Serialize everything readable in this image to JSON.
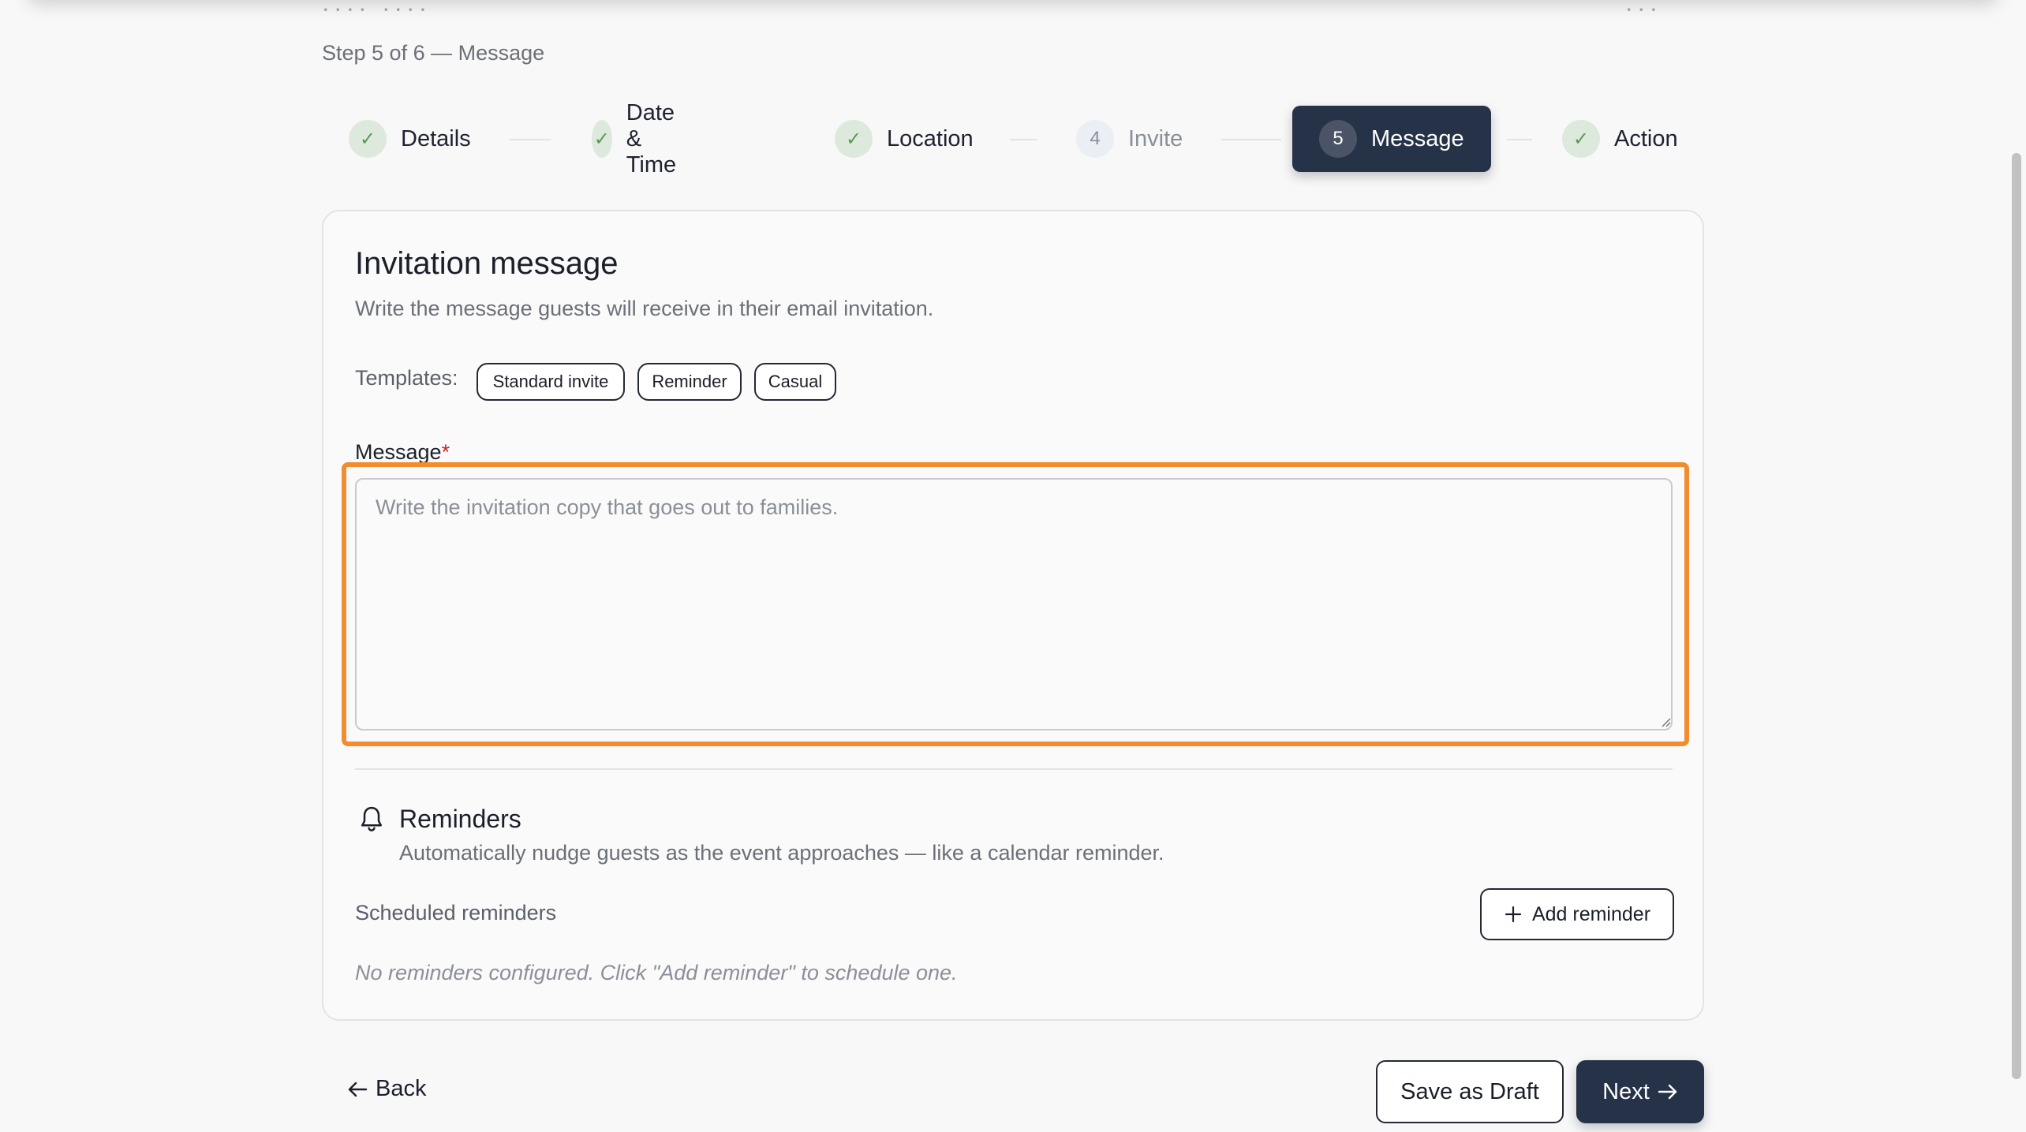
{
  "header": {
    "step_indicator": "Step 5 of 6 — Message"
  },
  "stepper": {
    "steps": [
      {
        "label": "Details",
        "state": "done",
        "marker": "✓"
      },
      {
        "label": "Date & Time",
        "state": "done",
        "marker": "✓"
      },
      {
        "label": "Location",
        "state": "done",
        "marker": "✓"
      },
      {
        "label": "Invite",
        "state": "upcoming",
        "marker": "4"
      },
      {
        "label": "Message",
        "state": "current",
        "marker": "5"
      },
      {
        "label": "Action",
        "state": "done",
        "marker": "✓"
      }
    ]
  },
  "card": {
    "title": "Invitation message",
    "subtitle": "Write the message guests will receive in their email invitation.",
    "templates_label": "Templates:",
    "templates": [
      "Standard invite",
      "Reminder",
      "Casual"
    ],
    "message_label": "Message",
    "required_marker": "*",
    "message_placeholder": "Write the invitation copy that goes out to families.",
    "message_value": ""
  },
  "reminders": {
    "icon": "bell-icon",
    "title": "Reminders",
    "subtitle": "Automatically nudge guests as the event approaches — like a calendar reminder.",
    "scheduled_label": "Scheduled reminders",
    "add_button_label": "Add reminder",
    "empty_text": "No reminders configured. Click \"Add reminder\" to schedule one."
  },
  "footer": {
    "back_label": "Back",
    "save_draft_label": "Save as Draft",
    "next_label": "Next"
  },
  "colors": {
    "primary": "#253247",
    "highlight": "#f28c2c",
    "done_check": "#5b9a57",
    "required": "#c62828"
  }
}
